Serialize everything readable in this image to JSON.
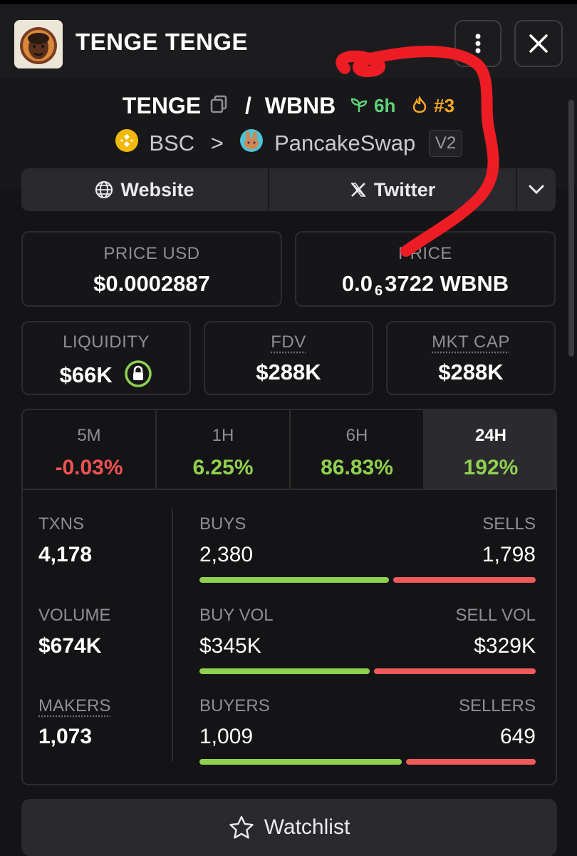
{
  "header": {
    "title": "TENGE TENGE",
    "avatar_icon": "token-avatar-icon",
    "menu_icon": "more-vertical-icon",
    "close_icon": "close-icon"
  },
  "pair": {
    "base": "TENGE",
    "separator": "/",
    "quote": "WBNB",
    "age": "6h",
    "rank": "#3",
    "colors": {
      "age": "#5fd27a",
      "rank": "#f5a623"
    }
  },
  "chain": {
    "network": "BSC",
    "arrow": ">",
    "dex": "PancakeSwap",
    "version": "V2"
  },
  "links": {
    "website": "Website",
    "twitter": "Twitter"
  },
  "price": {
    "usd_label": "PRICE USD",
    "usd_value": "$0.0002887",
    "native_label": "PRICE",
    "native_prefix": "0.0",
    "native_subscript": "6",
    "native_digits": "3722 WBNB"
  },
  "metrics": {
    "liquidity_label": "LIQUIDITY",
    "liquidity_value": "$66K",
    "fdv_label": "FDV",
    "fdv_value": "$288K",
    "mktcap_label": "MKT CAP",
    "mktcap_value": "$288K"
  },
  "timeframes": [
    {
      "label": "5M",
      "value": "-0.03%"
    },
    {
      "label": "1H",
      "value": "6.25%"
    },
    {
      "label": "6H",
      "value": "86.83%"
    },
    {
      "label": "24H",
      "value": "192%"
    }
  ],
  "activity": {
    "txns_label": "TXNS",
    "txns_value": "4,178",
    "volume_label": "VOLUME",
    "volume_value": "$674K",
    "makers_label": "MAKERS",
    "makers_value": "1,073",
    "buys_label": "BUYS",
    "buys_value": "2,380",
    "sells_label": "SELLS",
    "sells_value": "1,798",
    "buy_vol_label": "BUY VOL",
    "buy_vol_value": "$345K",
    "sell_vol_label": "SELL VOL",
    "sell_vol_value": "$329K",
    "buyers_label": "BUYERS",
    "buyers_value": "1,009",
    "sellers_label": "SELLERS",
    "sellers_value": "649",
    "buy_share_txns": 0.57,
    "buy_share_volume": 0.512,
    "buy_share_buyers": 0.609
  },
  "watchlist": {
    "label": "Watchlist",
    "icon": "star-outline-icon"
  },
  "colors": {
    "positive": "#8fd14f",
    "negative": "#f05252",
    "annotation": "#ee1c25"
  }
}
